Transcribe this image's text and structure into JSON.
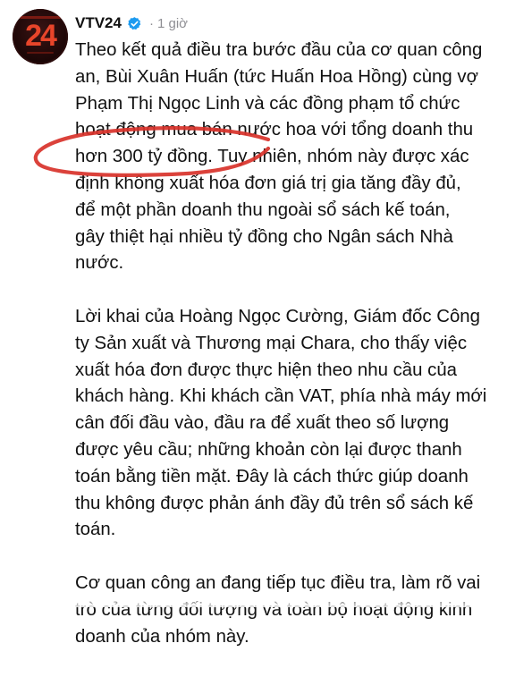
{
  "post": {
    "author": "VTV24",
    "separator": "·",
    "time": "1 giờ",
    "avatar_mark": "24",
    "paragraphs": [
      [
        "Theo kết quả điều tra bước đầu của cơ quan công",
        "an, Bùi Xuân Huấn (tức Huấn Hoa Hồng) cùng vợ",
        "Phạm Thị Ngọc Linh và các đồng phạm tổ chức",
        "hoạt động mua bán nước hoa với tổng doanh thu",
        "hơn 300 tỷ đồng. Tuy nhiên, nhóm này được xác",
        "định không xuất hóa đơn giá trị gia tăng đầy đủ,",
        "để một phần doanh thu ngoài sổ sách kế toán,",
        "gây thiệt hại nhiều tỷ đồng cho Ngân sách Nhà",
        "nước."
      ],
      [
        "Lời khai của Hoàng Ngọc Cường, Giám đốc Công",
        "ty Sản xuất và Thương mại Chara, cho thấy việc",
        "xuất hóa đơn được thực hiện theo nhu cầu của",
        "khách hàng. Khi khách cần VAT, phía nhà máy mới",
        "cân đối đầu vào, đầu ra để xuất theo số lượng",
        "được yêu cầu; những khoản còn lại được thanh",
        "toán bằng tiền mặt. Đây là cách thức giúp doanh",
        "thu không được phản ánh đầy đủ trên sổ sách kế",
        "toán."
      ],
      [
        "Cơ quan công an đang tiếp tục điều tra, làm rõ vai",
        "trò của từng đối tượng và toàn bộ hoạt động kinh",
        "doanh của nhóm này."
      ]
    ],
    "colors": {
      "verified": "#1d9bf0",
      "annotation": "#d8322a",
      "muted": "#8e8e93"
    }
  }
}
